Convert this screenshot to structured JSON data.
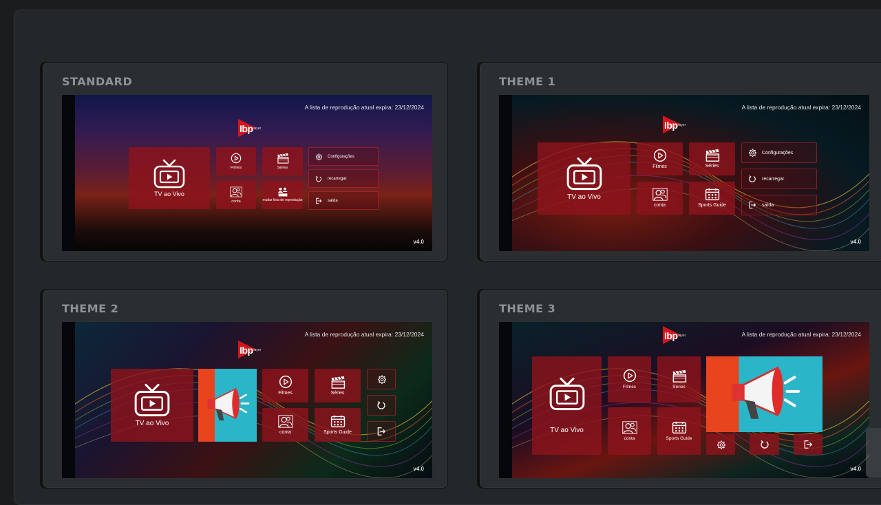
{
  "themes": [
    {
      "title": "STANDARD",
      "expiry": "A lista de reprodução atual expira: 23/12/2024",
      "logo_text": "Ibp",
      "logo_sub": "layer",
      "version": "v4.0",
      "tiles": {
        "live": "TV ao Vivo",
        "movies": "Filmes",
        "series": "Séries",
        "account": "conta",
        "change_playlist": "mudar lista de reprodução"
      },
      "side": {
        "settings": "Configurações",
        "reload": "recarregar",
        "exit": "saída"
      }
    },
    {
      "title": "THEME 1",
      "expiry": "A lista de reprodução atual expira: 23/12/2024",
      "logo_text": "Ibp",
      "logo_sub": "layer",
      "version": "v4.0",
      "tiles": {
        "live": "TV ao Vivo",
        "movies": "Filmes",
        "series": "Séries",
        "account": "conta",
        "sports": "Sports Guide"
      },
      "side": {
        "settings": "Configurações",
        "reload": "recarregar",
        "exit": "saída"
      }
    },
    {
      "title": "THEME 2",
      "expiry": "A lista de reprodução atual expira: 23/12/2024",
      "logo_text": "Ibp",
      "logo_sub": "layer",
      "version": "v4.0",
      "tiles": {
        "live": "TV ao Vivo",
        "movies": "Filmes",
        "series": "Séries",
        "account": "conta",
        "sports": "Sports Guide"
      }
    },
    {
      "title": "THEME 3",
      "expiry": "A lista de reprodução atual expira: 23/12/2024",
      "logo_text": "Ibp",
      "logo_sub": "layer",
      "version": "v4.0",
      "tiles": {
        "live": "TV ao Vivo",
        "movies": "Filmes",
        "series": "Séries",
        "account": "conta",
        "sports": "Sports Guide"
      }
    }
  ],
  "colors": {
    "tile": "#8c141c",
    "accent": "#d4161c",
    "promo_orange": "#e8451e",
    "promo_teal": "#2ab5c8"
  }
}
